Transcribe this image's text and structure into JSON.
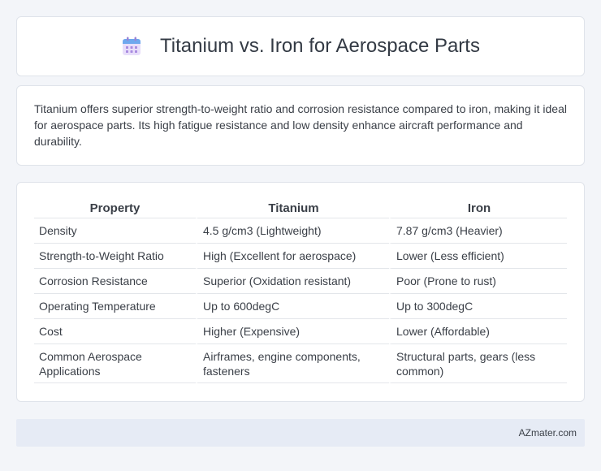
{
  "header": {
    "title": "Titanium vs. Iron for Aerospace Parts",
    "icon": "calendar-icon"
  },
  "description": {
    "text": "Titanium offers superior strength-to-weight ratio and corrosion resistance compared to iron, making it ideal for aerospace parts. Its high fatigue resistance and low density enhance aircraft performance and durability."
  },
  "table": {
    "headers": [
      "Property",
      "Titanium",
      "Iron"
    ],
    "rows": [
      [
        "Density",
        "4.5 g/cm3 (Lightweight)",
        "7.87 g/cm3 (Heavier)"
      ],
      [
        "Strength-to-Weight Ratio",
        "High (Excellent for aerospace)",
        "Lower (Less efficient)"
      ],
      [
        "Corrosion Resistance",
        "Superior (Oxidation resistant)",
        "Poor (Prone to rust)"
      ],
      [
        "Operating Temperature",
        "Up to 600degC",
        "Up to 300degC"
      ],
      [
        "Cost",
        "Higher (Expensive)",
        "Lower (Affordable)"
      ],
      [
        "Common Aerospace Applications",
        "Airframes, engine components, fasteners",
        "Structural parts, gears (less common)"
      ]
    ]
  },
  "footer": {
    "brand": "AZmater.com"
  }
}
